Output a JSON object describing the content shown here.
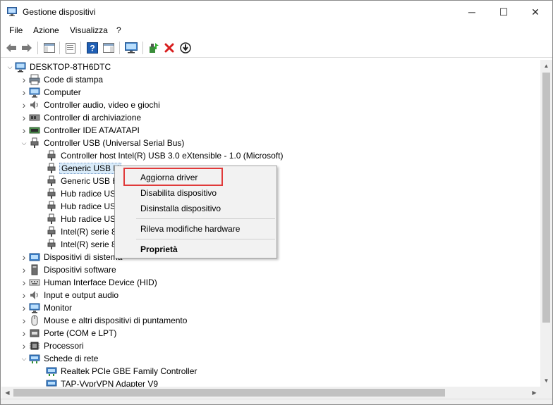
{
  "window": {
    "title": "Gestione dispositivi",
    "app_icon": "device-manager-icon",
    "controls": {
      "minimize": "─",
      "maximize": "☐",
      "close": "✕"
    }
  },
  "menu": [
    "File",
    "Azione",
    "Visualizza",
    "?"
  ],
  "toolbar": {
    "buttons": [
      "back-arrow-icon",
      "forward-arrow-icon",
      "show-hide-console-tree-icon",
      "properties-icon",
      "help-icon",
      "show-hide-action-pane-icon",
      "monitor-scan-icon",
      "update-driver-icon",
      "uninstall-device-icon",
      "disable-device-icon"
    ],
    "accent_red": "#d81e1e",
    "accent_blue": "#1f5fb5"
  },
  "tree": {
    "root": "DESKTOP-8TH6DTC",
    "items": [
      {
        "label": "Code di stampa",
        "icon": "print-queue-icon",
        "level": 1,
        "expander": "collapsed"
      },
      {
        "label": "Computer",
        "icon": "computer-icon",
        "level": 1,
        "expander": "collapsed"
      },
      {
        "label": "Controller audio, video e giochi",
        "icon": "audio-icon",
        "level": 1,
        "expander": "collapsed"
      },
      {
        "label": "Controller di archiviazione",
        "icon": "storage-controller-icon",
        "level": 1,
        "expander": "collapsed"
      },
      {
        "label": "Controller IDE ATA/ATAPI",
        "icon": "ide-controller-icon",
        "level": 1,
        "expander": "collapsed"
      },
      {
        "label": "Controller USB (Universal Serial Bus)",
        "icon": "usb-icon",
        "level": 1,
        "expander": "expanded"
      },
      {
        "label": "Controller host Intel(R) USB 3.0 eXtensible - 1.0 (Microsoft)",
        "icon": "usb-icon",
        "level": 2,
        "expander": "none"
      },
      {
        "label": "Generic USB H",
        "icon": "usb-icon",
        "level": 2,
        "expander": "none",
        "selected": true
      },
      {
        "label": "Generic USB H",
        "icon": "usb-icon",
        "level": 2,
        "expander": "none"
      },
      {
        "label": "Hub radice USI",
        "icon": "usb-icon",
        "level": 2,
        "expander": "none"
      },
      {
        "label": "Hub radice USI",
        "icon": "usb-icon",
        "level": 2,
        "expander": "none"
      },
      {
        "label": "Hub radice USI",
        "icon": "usb-icon",
        "level": 2,
        "expander": "none"
      },
      {
        "label": "Intel(R) serie 8/",
        "icon": "usb-icon",
        "level": 2,
        "expander": "none"
      },
      {
        "label": "Intel(R) serie 8/",
        "icon": "usb-icon",
        "level": 2,
        "expander": "none"
      },
      {
        "label": "Dispositivi di sistema",
        "icon": "system-devices-icon",
        "level": 1,
        "expander": "collapsed"
      },
      {
        "label": "Dispositivi software",
        "icon": "software-device-icon",
        "level": 1,
        "expander": "collapsed"
      },
      {
        "label": "Human Interface Device (HID)",
        "icon": "hid-icon",
        "level": 1,
        "expander": "collapsed"
      },
      {
        "label": "Input e output audio",
        "icon": "audio-io-icon",
        "level": 1,
        "expander": "collapsed"
      },
      {
        "label": "Monitor",
        "icon": "monitor-icon",
        "level": 1,
        "expander": "collapsed"
      },
      {
        "label": "Mouse e altri dispositivi di puntamento",
        "icon": "mouse-icon",
        "level": 1,
        "expander": "collapsed"
      },
      {
        "label": "Porte (COM e LPT)",
        "icon": "port-icon",
        "level": 1,
        "expander": "collapsed"
      },
      {
        "label": "Processori",
        "icon": "processor-icon",
        "level": 1,
        "expander": "collapsed"
      },
      {
        "label": "Schede di rete",
        "icon": "network-adapter-icon",
        "level": 1,
        "expander": "expanded"
      },
      {
        "label": "Realtek PCIe GBE Family Controller",
        "icon": "network-adapter-icon",
        "level": 2,
        "expander": "none"
      },
      {
        "label": "TAP-VyprVPN Adapter V9",
        "icon": "network-adapter-icon",
        "level": 2,
        "expander": "none"
      }
    ]
  },
  "context_menu": {
    "items": [
      {
        "label": "Aggiorna driver",
        "bold": false
      },
      {
        "label": "Disabilita dispositivo",
        "bold": false
      },
      {
        "label": "Disinstalla dispositivo",
        "bold": false
      },
      {
        "label": "Rileva modifiche hardware",
        "bold": false
      },
      {
        "label": "Proprietà",
        "bold": true
      }
    ],
    "highlight_color": "#e03a3a"
  }
}
